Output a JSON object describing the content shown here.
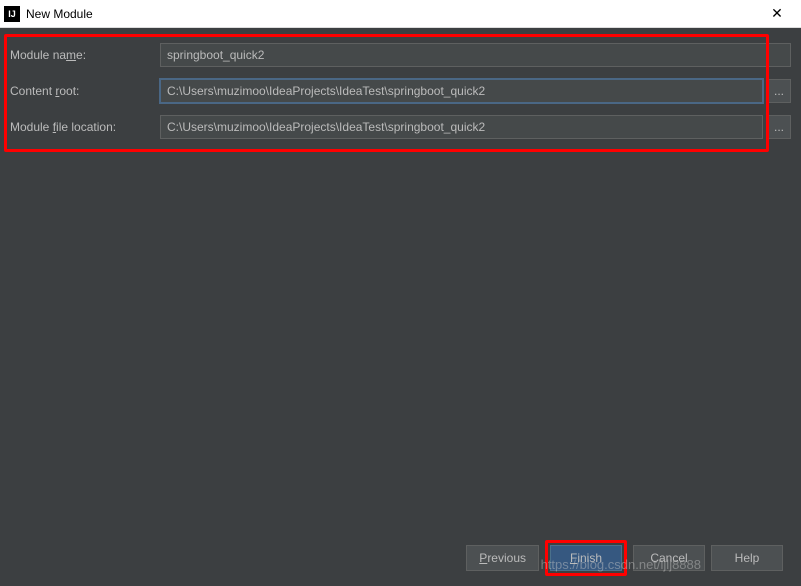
{
  "titlebar": {
    "icon_text": "IJ",
    "title": "New Module",
    "close_symbol": "✕"
  },
  "form": {
    "module_name": {
      "label": "Module name:",
      "value": "springboot_quick2"
    },
    "content_root": {
      "label": "Content root:",
      "value": "C:\\Users\\muzimoo\\IdeaProjects\\IdeaTest\\springboot_quick2",
      "browse": "..."
    },
    "module_file_location": {
      "label": "Module file location:",
      "value": "C:\\Users\\muzimoo\\IdeaProjects\\IdeaTest\\springboot_quick2",
      "browse": "..."
    }
  },
  "buttons": {
    "previous": "Previous",
    "finish": "Finish",
    "cancel": "Cancel",
    "help": "Help"
  },
  "watermark": "https://blog.csdn.net/ljlj8888"
}
